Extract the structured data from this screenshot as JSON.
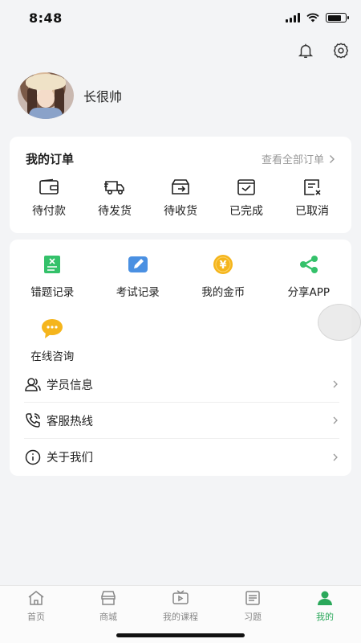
{
  "status_bar": {
    "time": "8:48"
  },
  "profile": {
    "username": "长很帅"
  },
  "orders": {
    "title": "我的订单",
    "view_all": "查看全部订单",
    "items": [
      {
        "label": "待付款",
        "icon": "wallet-icon"
      },
      {
        "label": "待发货",
        "icon": "truck-icon"
      },
      {
        "label": "待收货",
        "icon": "box-icon"
      },
      {
        "label": "已完成",
        "icon": "check-box-icon"
      },
      {
        "label": "已取消",
        "icon": "cancel-doc-icon"
      }
    ]
  },
  "tools": [
    {
      "label": "错题记录",
      "icon": "wrong-notes-icon"
    },
    {
      "label": "考试记录",
      "icon": "exam-record-icon"
    },
    {
      "label": "我的金币",
      "icon": "gold-coin-icon"
    },
    {
      "label": "分享APP",
      "icon": "share-icon"
    },
    {
      "label": "在线咨询",
      "icon": "chat-bubble-icon"
    }
  ],
  "menu": [
    {
      "label": "学员信息",
      "icon": "users-icon"
    },
    {
      "label": "客服热线",
      "icon": "phone-icon"
    },
    {
      "label": "关于我们",
      "icon": "info-icon"
    }
  ],
  "tabbar": [
    {
      "label": "首页",
      "icon": "home-icon"
    },
    {
      "label": "商城",
      "icon": "store-icon"
    },
    {
      "label": "我的课程",
      "icon": "tv-icon"
    },
    {
      "label": "习题",
      "icon": "list-icon"
    },
    {
      "label": "我的",
      "icon": "person-icon"
    }
  ],
  "colors": {
    "accent": "#2aa85a",
    "background": "#f3f4f6",
    "coin": "#f5b51c",
    "exam_blue": "#4a90e2"
  }
}
